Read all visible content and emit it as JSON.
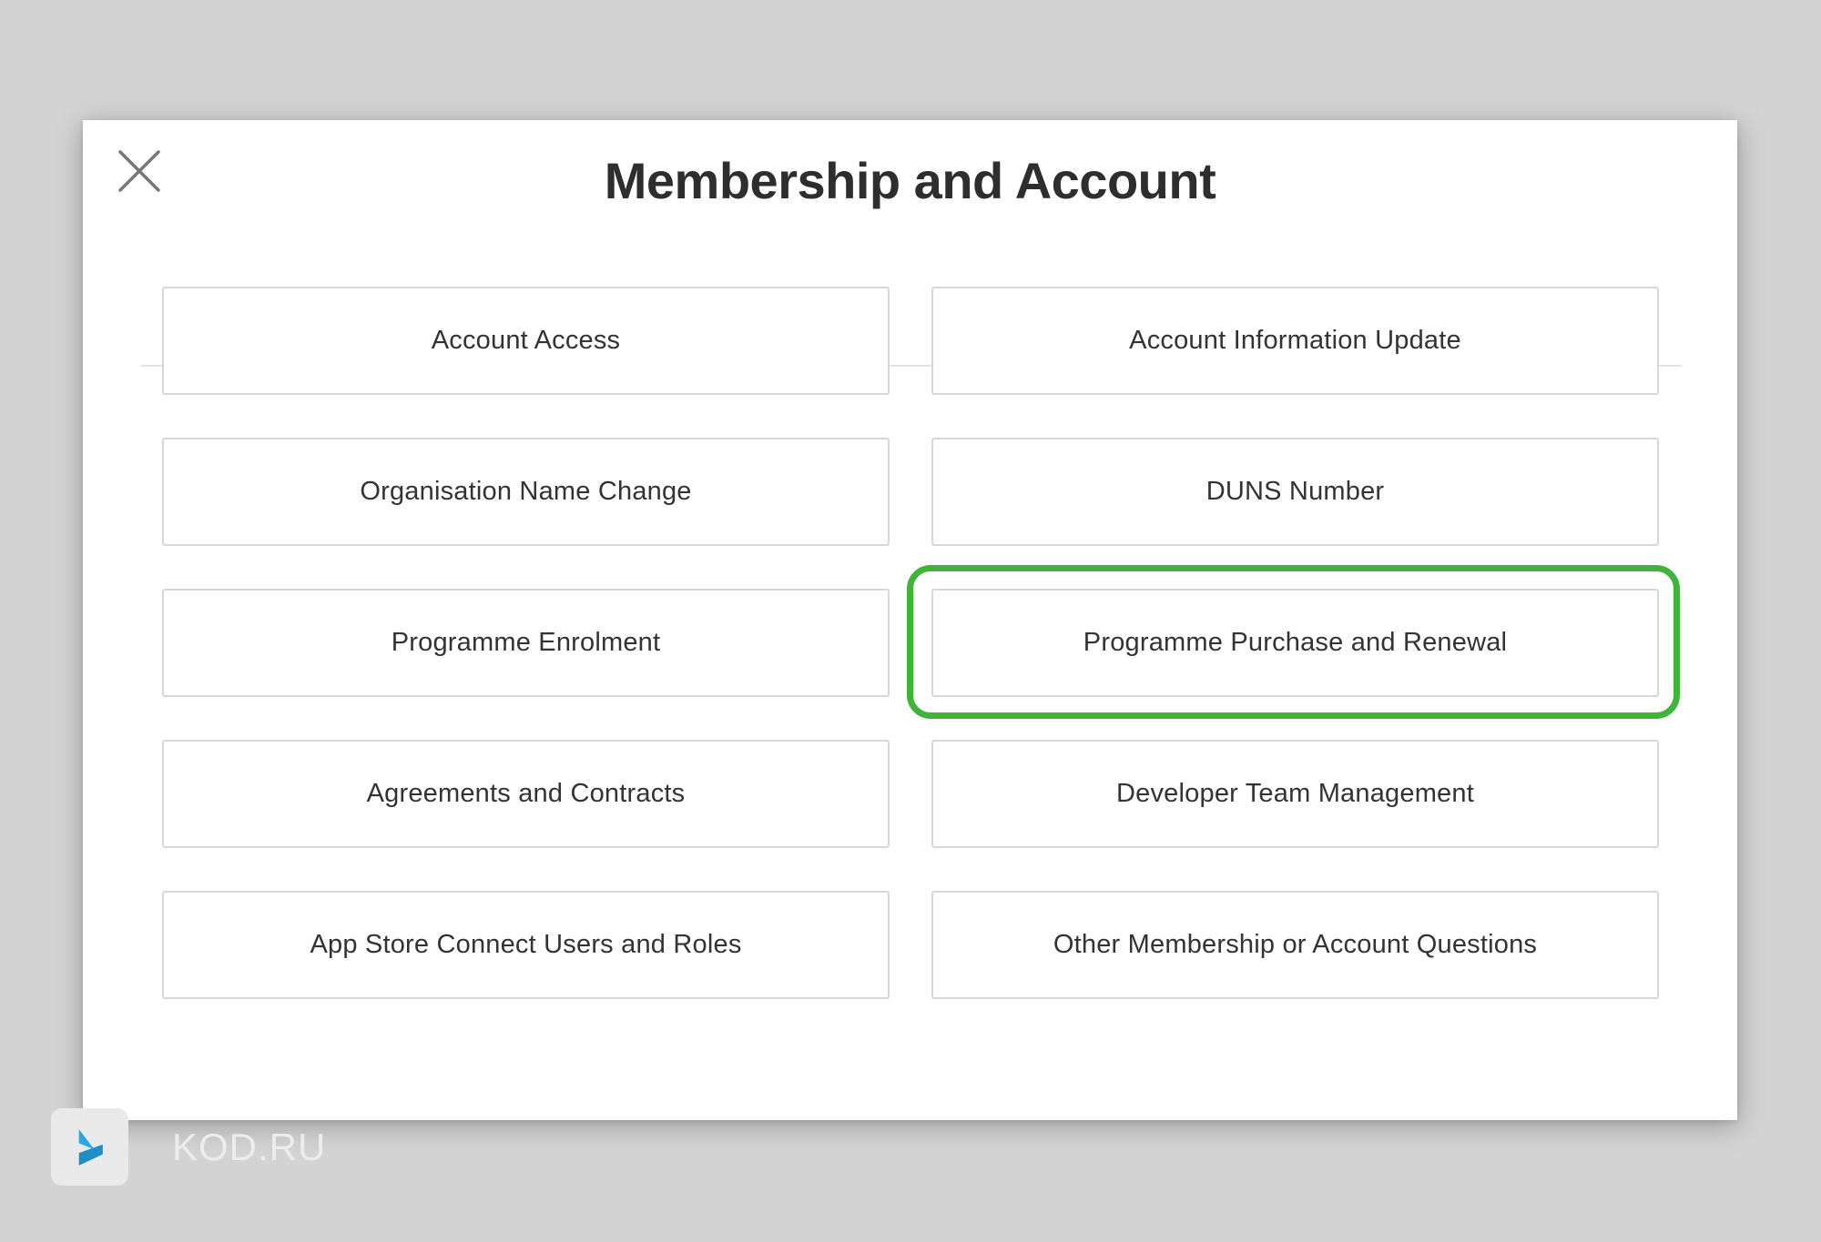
{
  "dialog": {
    "title": "Membership and Account",
    "close_icon": "close-icon",
    "options": [
      {
        "label": "Account Access"
      },
      {
        "label": "Account Information Update"
      },
      {
        "label": "Organisation Name Change"
      },
      {
        "label": "DUNS Number"
      },
      {
        "label": "Programme Enrolment"
      },
      {
        "label": "Programme Purchase and Renewal",
        "highlighted": true
      },
      {
        "label": "Agreements and Contracts"
      },
      {
        "label": "Developer Team Management"
      },
      {
        "label": "App Store Connect Users and Roles"
      },
      {
        "label": "Other Membership or Account Questions"
      }
    ]
  },
  "highlight": {
    "color": "#3fb33a"
  },
  "watermark": {
    "text": "KOD.RU",
    "logo_icon": "kod-logo-icon",
    "logo_color": "#29a8e0"
  },
  "colors": {
    "background": "#d3d3d3",
    "modal": "#ffffff",
    "title": "#2e2e2e",
    "option_border": "#d7d7d7"
  }
}
